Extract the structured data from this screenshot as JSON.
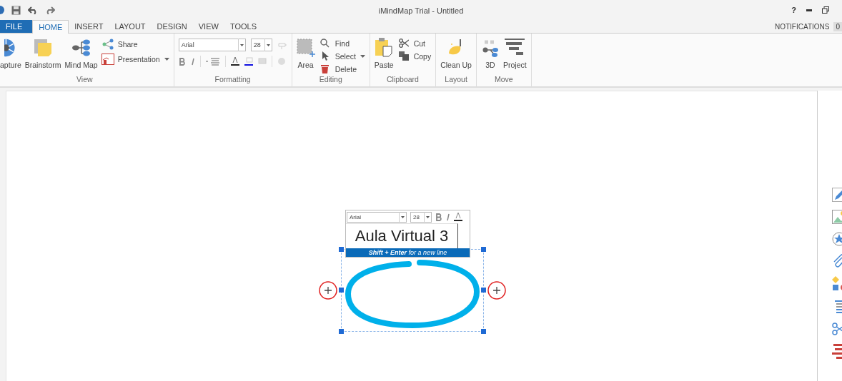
{
  "window": {
    "title": "iMindMap Trial - Untitled",
    "help": "?"
  },
  "tabs": [
    {
      "label": "FILE",
      "kind": "file",
      "selected": false
    },
    {
      "label": "HOME",
      "kind": "tab",
      "selected": true
    },
    {
      "label": "INSERT",
      "kind": "tab",
      "selected": false
    },
    {
      "label": "LAYOUT",
      "kind": "tab",
      "selected": false
    },
    {
      "label": "DESIGN",
      "kind": "tab",
      "selected": false
    },
    {
      "label": "VIEW",
      "kind": "tab",
      "selected": false
    },
    {
      "label": "TOOLS",
      "kind": "tab",
      "selected": false
    }
  ],
  "notifications": {
    "label": "NOTIFICATIONS",
    "count": "0"
  },
  "ribbon": [
    {
      "title": "View",
      "large": [
        {
          "label": "apture"
        },
        {
          "label": "Brainstorm"
        },
        {
          "label": "Mind Map"
        }
      ],
      "small": [
        {
          "label": "Share",
          "dropdown": false
        },
        {
          "label": "Presentation",
          "dropdown": true
        }
      ]
    },
    {
      "title": "Formatting",
      "font": "Arial",
      "size": "28"
    },
    {
      "title": "Editing",
      "large": [
        {
          "label": "Area"
        }
      ],
      "small": [
        {
          "label": "Find",
          "dropdown": false
        },
        {
          "label": "Select",
          "dropdown": true
        },
        {
          "label": "Delete",
          "dropdown": false
        }
      ]
    },
    {
      "title": "Clipboard",
      "large": [
        {
          "label": "Paste"
        }
      ],
      "small": [
        {
          "label": "Cut",
          "dropdown": false
        },
        {
          "label": "Copy",
          "dropdown": false
        }
      ]
    },
    {
      "title": "Layout",
      "large": [
        {
          "label": "Clean Up"
        }
      ]
    },
    {
      "title": "Move",
      "large": [
        {
          "label": "3D"
        },
        {
          "label": "Project"
        }
      ]
    }
  ],
  "editor": {
    "font": "Arial",
    "size": "28",
    "text": "Aula Virtual 3",
    "hint": "**Shift + Enter** for a new line"
  }
}
